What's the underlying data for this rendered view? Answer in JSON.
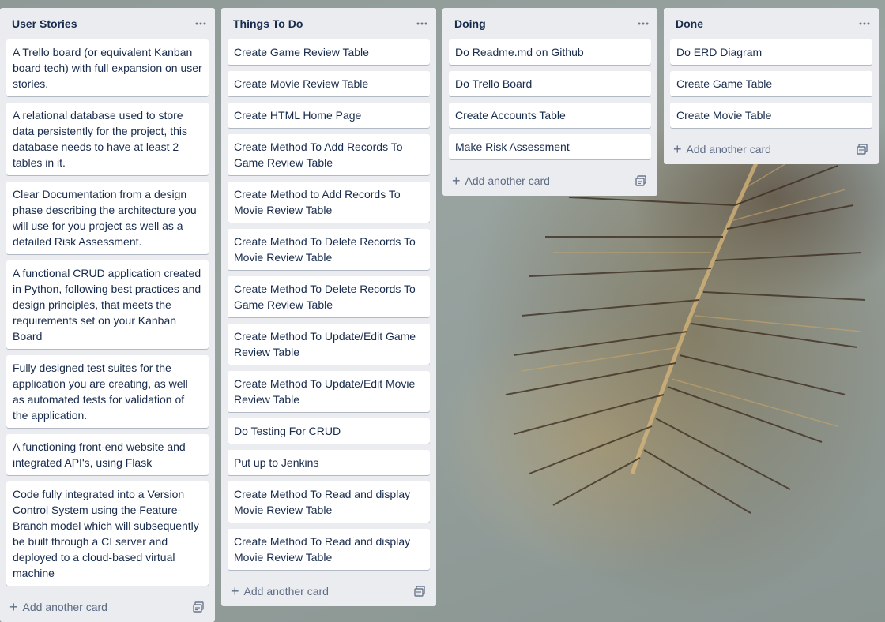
{
  "lists": [
    {
      "title": "User Stories",
      "cards": [
        "A Trello board (or equivalent Kanban board tech) with full expansion on user stories.",
        "A relational database used to store data persistently for the project, this database needs to have at least 2 tables in it.",
        "Clear Documentation from a design phase describing the architecture you will use for you project as well as a detailed Risk Assessment.",
        "A functional CRUD application created in Python, following best practices and design principles, that meets the requirements set on your Kanban Board",
        "Fully designed test suites for the application you are creating, as well as automated tests for validation of the application.",
        "A functioning front-end website and integrated API's, using Flask",
        "Code fully integrated into a Version Control System using the Feature-Branch model which will subsequently be built through a CI server and deployed to a cloud-based virtual machine"
      ],
      "add_label": "Add another card"
    },
    {
      "title": "Things To Do",
      "cards": [
        "Create Game Review Table",
        "Create Movie Review Table",
        "Create HTML Home Page",
        "Create Method To Add Records To Game Review Table",
        "Create Method to Add Records To Movie Review Table",
        "Create Method To Delete Records To Movie Review Table",
        "Create Method To Delete Records To Game Review Table",
        "Create Method To Update/Edit Game Review Table",
        "Create Method To Update/Edit Movie Review Table",
        "Do Testing For CRUD",
        "Put up to Jenkins",
        "Create Method To Read and display Movie Review Table",
        "Create Method To Read and display Movie Review Table"
      ],
      "add_label": "Add another card"
    },
    {
      "title": "Doing",
      "cards": [
        "Do Readme.md on Github",
        "Do Trello Board",
        "Create Accounts Table",
        "Make Risk Assessment"
      ],
      "add_label": "Add another card"
    },
    {
      "title": "Done",
      "cards": [
        "Do ERD Diagram",
        "Create Game Table",
        "Create Movie Table"
      ],
      "add_label": "Add another card"
    }
  ],
  "icons": {
    "list_menu": "more-horizontal-icon",
    "add": "plus-icon",
    "template": "card-template-icon"
  },
  "colors": {
    "list_bg": "#ebecf0",
    "card_bg": "#ffffff",
    "title_text": "#172b4d",
    "muted_text": "#5e6c84"
  }
}
